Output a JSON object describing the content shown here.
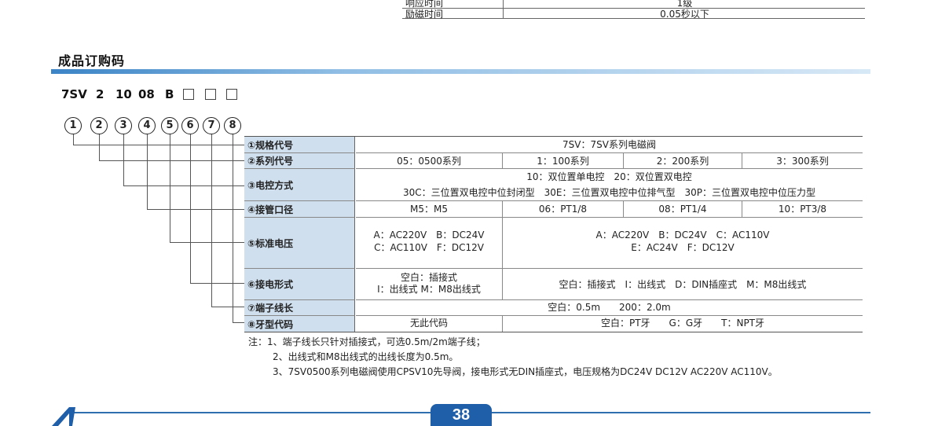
{
  "top_table": {
    "row1": {
      "label": "响应时间",
      "value": "1级"
    },
    "row2": {
      "label": "励磁时间",
      "value": "0.05秒以下"
    }
  },
  "section_title": "成品订购码",
  "order_code": {
    "parts": [
      "7SV",
      "2",
      "10",
      "08",
      "B"
    ],
    "circles": [
      "1",
      "2",
      "3",
      "4",
      "5",
      "6",
      "7",
      "8"
    ]
  },
  "table": {
    "rows": [
      {
        "label": "①规格代号",
        "cells": [
          "7SV：7SV系列电磁阀"
        ]
      },
      {
        "label": "②系列代号",
        "cells": [
          "05：0500系列",
          "1：100系列",
          "2：200系列",
          "3：300系列"
        ]
      },
      {
        "label": "③电控方式",
        "cells": [
          "10：双位置单电控　20：双位置双电控",
          "30C：三位置双电控中位封闭型　30E：三位置双电控中位排气型　30P：三位置双电控中位压力型"
        ]
      },
      {
        "label": "④接管口径",
        "cells": [
          "M5：M5",
          "06：PT1/8",
          "08：PT1/4",
          "10：PT3/8"
        ]
      },
      {
        "label": "⑤标准电压",
        "cells": [
          "A：AC220V　B：DC24V",
          "C：AC110V　F：DC12V",
          "A：AC220V　B：DC24V　C：AC110V",
          "E：AC24V　F：DC12V"
        ]
      },
      {
        "label": "⑥接电形式",
        "cells": [
          "空白：插接式",
          "I：出线式 M：M8出线式",
          "空白：插接式　I：出线式　D：DIN插座式　M：M8出线式"
        ]
      },
      {
        "label": "⑦端子线长",
        "cells": [
          "空白：0.5m　　200：2.0m"
        ]
      },
      {
        "label": "⑧牙型代码",
        "cells": [
          "无此代码",
          "空白：PT牙　　G：G牙　　T：NPT牙"
        ]
      }
    ]
  },
  "notes": [
    "注：1、端子线长只针对插接式，可选0.5m/2m端子线；",
    "2、出线式和M8出线式的出线长度为0.5m。",
    "3、7SV0500系列电磁阀使用CPSV10先导阀，接电形式无DIN插座式，电压规格为DC24V DC12V AC220V AC110V。"
  ],
  "page_number": "38",
  "colors": {
    "accent": "#1f5ea8",
    "label_bg": "#cfdfee"
  }
}
